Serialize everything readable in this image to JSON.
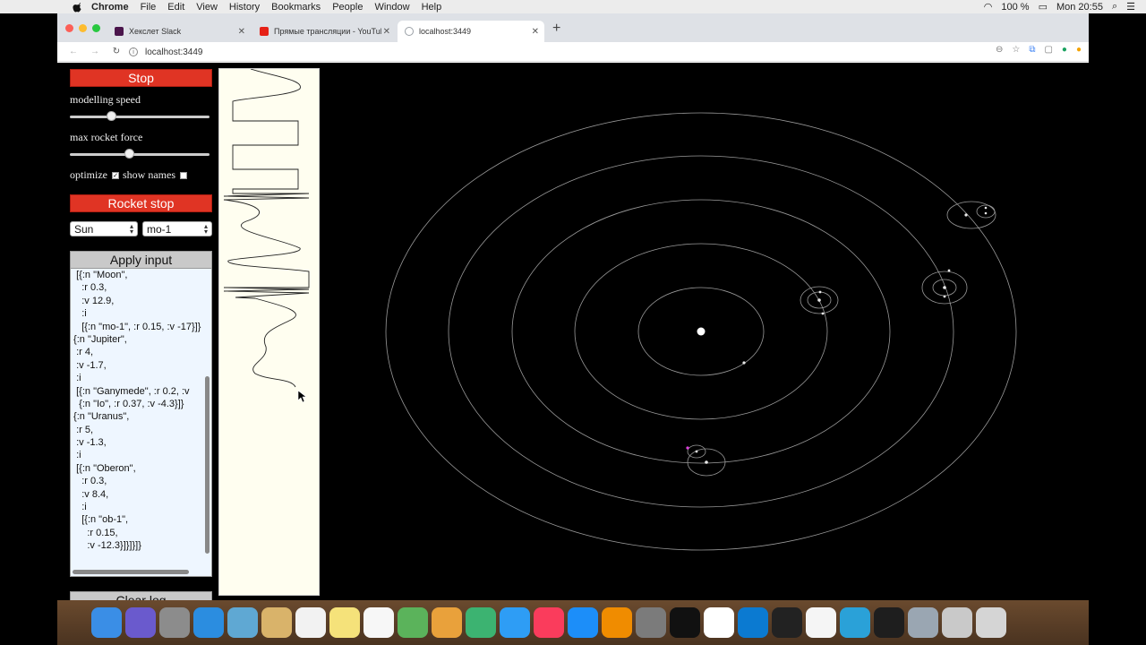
{
  "menubar": {
    "app": "Chrome",
    "items": [
      "File",
      "Edit",
      "View",
      "History",
      "Bookmarks",
      "People",
      "Window",
      "Help"
    ],
    "battery": "100 %",
    "clock": "Mon 20:55"
  },
  "tabs": [
    {
      "title": "Хекслет Slack",
      "fav_color": "#4a154b"
    },
    {
      "title": "Прямые трансляции - YouTube",
      "fav_color": "#e62117"
    },
    {
      "title": "localhost:3449",
      "fav_color": "#9aa0a6"
    }
  ],
  "address": {
    "url": "localhost:3449"
  },
  "controls": {
    "stop_label": "Stop",
    "modelling_speed_label": "modelling speed",
    "modelling_speed_value": 0.28,
    "max_rocket_force_label": "max rocket force",
    "max_rocket_force_value": 0.42,
    "optimize_label": "optimize",
    "optimize_checked": true,
    "show_names_label": "show names",
    "show_names_checked": false,
    "rocket_stop_label": "Rocket stop",
    "from_select": "Sun",
    "to_select": "mo-1",
    "apply_label": "Apply input",
    "clear_log_label": "Clear log"
  },
  "input_lines": [
    "  [{:n \"Moon\",",
    "    :r 0.3,",
    "    :v 12.9,",
    "    :i",
    "    [{:n \"mo-1\", :r 0.15, :v -17}]}",
    " {:n \"Jupiter\",",
    "  :r 4,",
    "  :v -1.7,",
    "  :i",
    "  [{:n \"Ganymede\", :r 0.2, :v",
    "   {:n \"Io\", :r 0.37, :v -4.3}]}",
    " {:n \"Uranus\",",
    "  :r 5,",
    "  :v -1.3,",
    "  :i",
    "  [{:n \"Oberon\",",
    "    :r 0.3,",
    "    :v 8.4,",
    "    :i",
    "    [{:n \"ob-1\",",
    "      :r 0.15,",
    "      :v -12.3}]}]}]}"
  ],
  "dock": [
    "Finder",
    "Siri",
    "Launchpad",
    "Safari",
    "Preview",
    "Notes",
    "Calendar",
    "Stickies",
    "Reminders",
    "Maps",
    "Photos",
    "FaceTime",
    "Messages",
    "Music",
    "App Store",
    "Books",
    "System Preferences",
    "IntelliJ",
    "Chrome",
    "VS Code",
    "Terminal",
    "TextEdit",
    "Telegram",
    "Activity Monitor",
    "Image Capture",
    "Downloads",
    "Trash"
  ],
  "colors": {
    "accent_red": "#e03424",
    "log_bg": "#fffef0",
    "input_bg": "#eef6ff"
  }
}
